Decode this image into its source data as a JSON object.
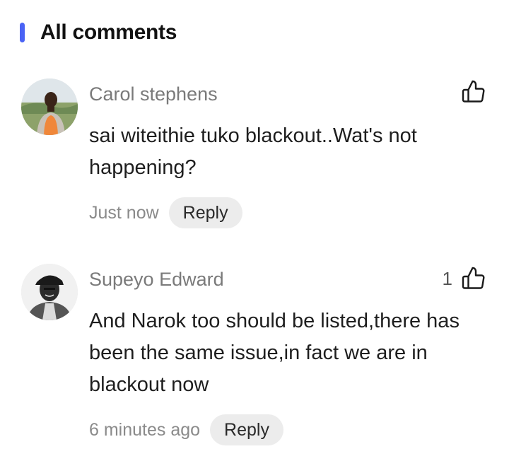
{
  "section": {
    "title": "All comments",
    "accent_color": "#4a63f5"
  },
  "comments": [
    {
      "author": "Carol stephens",
      "text": "sai witeithie tuko blackout..Wat's not happening?",
      "time": "Just now",
      "reply_label": "Reply",
      "like_count": "",
      "like_icon": "thumbs-up-outline"
    },
    {
      "author": "Supeyo Edward",
      "text": "And Narok too should be listed,there has been the same issue,in fact we are in blackout now",
      "time": "6 minutes ago",
      "reply_label": "Reply",
      "like_count": "1",
      "like_icon": "thumbs-up-outline"
    }
  ]
}
